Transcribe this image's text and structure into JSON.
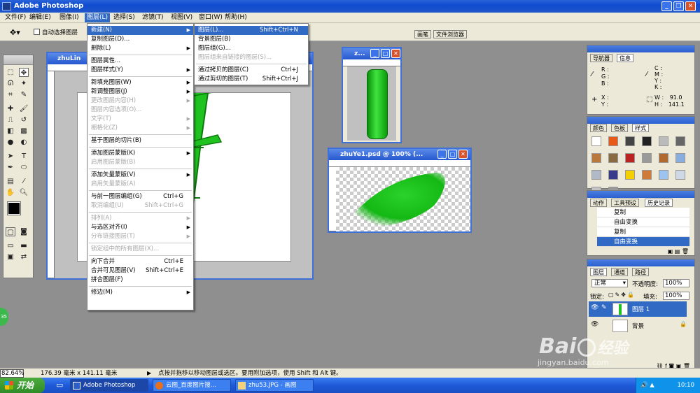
{
  "app": {
    "title": "Adobe Photoshop"
  },
  "menubar": [
    "文件(F)",
    "编辑(E)",
    "图像(I)",
    "图层(L)",
    "选择(S)",
    "滤镜(T)",
    "视图(V)",
    "窗口(W)",
    "帮助(H)"
  ],
  "options": {
    "auto_select": "自动选择图层"
  },
  "dock_tabs": [
    "画笔",
    "文件浏览器"
  ],
  "layer_menu": [
    {
      "label": "新建(N)",
      "arrow": true,
      "hl": true
    },
    {
      "label": "复制图层(D)..."
    },
    {
      "label": "删除(L)",
      "arrow": true
    },
    {
      "sep": true
    },
    {
      "label": "图层属性..."
    },
    {
      "label": "图层样式(Y)",
      "arrow": true
    },
    {
      "sep": true
    },
    {
      "label": "新填充图层(W)",
      "arrow": true
    },
    {
      "label": "新调整图层(J)",
      "arrow": true
    },
    {
      "label": "更改图层内容(H)",
      "arrow": true,
      "dis": true
    },
    {
      "label": "图层内容选项(O)...",
      "dis": true
    },
    {
      "label": "文字(T)",
      "arrow": true,
      "dis": true
    },
    {
      "label": "栅格化(Z)",
      "arrow": true,
      "dis": true
    },
    {
      "sep": true
    },
    {
      "label": "基于图层的切片(B)"
    },
    {
      "sep": true
    },
    {
      "label": "添加图层蒙版(K)",
      "arrow": true
    },
    {
      "label": "启用图层蒙版(B)",
      "dis": true
    },
    {
      "sep": true
    },
    {
      "label": "添加矢量蒙版(V)",
      "arrow": true
    },
    {
      "label": "启用矢量蒙版(A)",
      "dis": true
    },
    {
      "sep": true
    },
    {
      "label": "与前一图层编组(G)",
      "shortcut": "Ctrl+G"
    },
    {
      "label": "取消编组(U)",
      "shortcut": "Shift+Ctrl+G",
      "dis": true
    },
    {
      "sep": true
    },
    {
      "label": "排列(A)",
      "arrow": true,
      "dis": true
    },
    {
      "label": "与选区对齐(I)",
      "arrow": true
    },
    {
      "label": "分布链接图层(T)",
      "arrow": true,
      "dis": true
    },
    {
      "sep": true
    },
    {
      "label": "锁定组中的所有图层(X)...",
      "dis": true
    },
    {
      "sep": true
    },
    {
      "label": "向下合并",
      "shortcut": "Ctrl+E"
    },
    {
      "label": "合并可见图层(V)",
      "shortcut": "Shift+Ctrl+E"
    },
    {
      "label": "拼合图层(F)"
    },
    {
      "sep": true
    },
    {
      "label": "修边(M)",
      "arrow": true
    }
  ],
  "new_submenu": [
    {
      "label": "图层(L)...",
      "shortcut": "Shift+Ctrl+N",
      "hl": true
    },
    {
      "label": "背景图层(B)"
    },
    {
      "label": "图层组(G)..."
    },
    {
      "label": "图层组来自链接的图层(S)...",
      "dis": true
    },
    {
      "sep": true
    },
    {
      "label": "通过拷贝的图层(C)",
      "shortcut": "Ctrl+J"
    },
    {
      "label": "通过剪切的图层(T)",
      "shortcut": "Shift+Ctrl+J"
    }
  ],
  "docs": {
    "main_title": "zhuLin",
    "small_title": "z...",
    "leaf_title": "zhuYe1.psd @ 100% (..."
  },
  "navigator": {
    "tabs": [
      "导航器",
      "信息"
    ],
    "rgb": [
      "R :",
      "G :",
      "B :"
    ],
    "cmyk": [
      "C :",
      "M :",
      "Y :",
      "K :"
    ],
    "xy": [
      "X :",
      "Y :"
    ],
    "w_label": "W :",
    "h_label": "H :",
    "w": "91.0",
    "h": "141.1"
  },
  "color_panel": {
    "tabs": [
      "颜色",
      "色板",
      "样式"
    ]
  },
  "history": {
    "tabs": [
      "动作",
      "工具预设",
      "历史记录"
    ],
    "items": [
      "复制",
      "自由变换",
      "复制",
      "自由变换"
    ],
    "selected": 3
  },
  "layers": {
    "tabs": [
      "图层",
      "通道",
      "路径"
    ],
    "mode": "正常",
    "opacity_label": "不透明度:",
    "opacity": "100%",
    "lock_label": "锁定:",
    "fill_label": "填充:",
    "fill": "100%",
    "items": [
      {
        "name": "图层 1",
        "selected": true
      },
      {
        "name": "背景",
        "selected": false
      }
    ]
  },
  "status": {
    "zoom": "82.64%",
    "size": "176.39 毫米 x 141.11 毫米",
    "hint": "点按并拖移以移动图层或选区。要用附加选项，使用 Shift 和 Alt 键。"
  },
  "taskbar": {
    "start": "开始",
    "tasks": [
      "Adobe Photoshop",
      "云图_百度图片搜...",
      "zhu53.JPG - 画图"
    ],
    "time": "10:10"
  },
  "watermark": {
    "brand": "Bai",
    "brand2": "经验",
    "url": "jingyan.baidu.com"
  },
  "colors": {
    "bamboo": "#1fc21f",
    "titlebar": "#2658cf",
    "highlight": "#316ac5"
  }
}
